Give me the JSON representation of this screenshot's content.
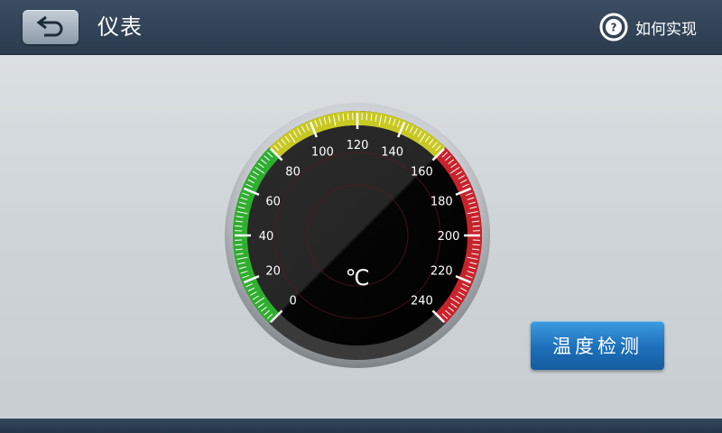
{
  "header": {
    "title": "仪表",
    "help_label": "如何实现"
  },
  "gauge": {
    "unit": "℃",
    "min": 0,
    "max": 240,
    "tick_labels": [
      "0",
      "20",
      "40",
      "60",
      "80",
      "100",
      "120",
      "140",
      "160",
      "180",
      "200",
      "220",
      "240"
    ],
    "zones": [
      {
        "name": "green",
        "from": 0,
        "to": 80,
        "color": "#2fae2f"
      },
      {
        "name": "yellow",
        "from": 80,
        "to": 160,
        "color": "#c8c823"
      },
      {
        "name": "red",
        "from": 160,
        "to": 240,
        "color": "#c8232b"
      }
    ]
  },
  "action": {
    "label": "温度检测"
  },
  "colors": {
    "header_bg": "#2f4156",
    "button_blue": "#1d6fba"
  }
}
